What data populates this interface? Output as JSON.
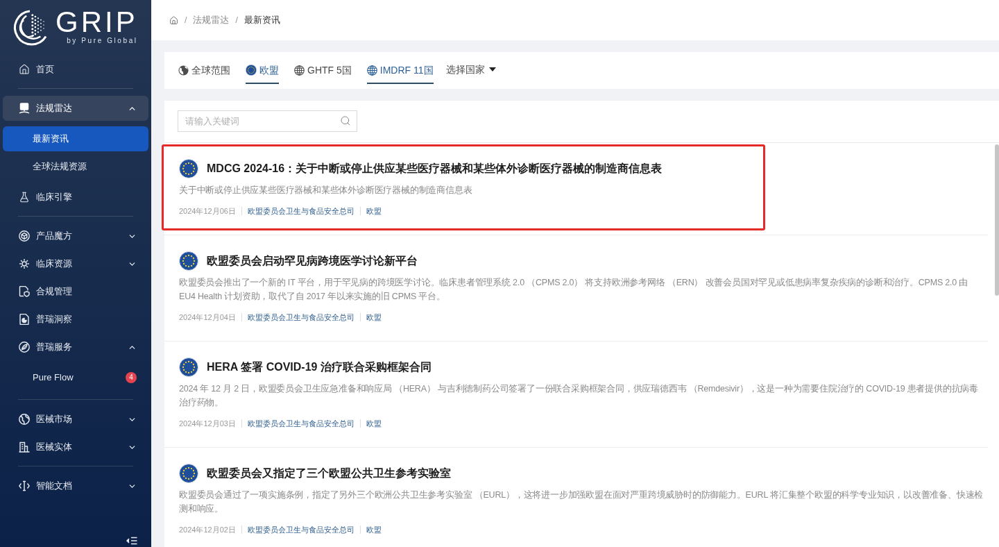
{
  "sidebar": {
    "logo": {
      "wordmark": "GRIP",
      "tagline": "by Pure Global"
    },
    "groups": [
      {
        "items": [
          {
            "label": "首页",
            "selected": false
          }
        ]
      },
      {
        "items": [
          {
            "label": "法规雷达",
            "selected": true,
            "expanded": true,
            "children": [
              {
                "label": "最新资讯",
                "selected": true
              },
              {
                "label": "全球法规资源",
                "selected": false
              }
            ]
          },
          {
            "label": "临床引擎",
            "selected": false
          }
        ]
      },
      {
        "items": [
          {
            "label": "产品魔方",
            "selected": false,
            "expanded": false
          },
          {
            "label": "临床资源",
            "selected": false,
            "expanded": false
          },
          {
            "label": "合规管理",
            "selected": false
          },
          {
            "label": "普瑞洞察",
            "selected": false
          },
          {
            "label": "普瑞服务",
            "selected": false,
            "expanded": true,
            "children": [
              {
                "label": "Pure Flow",
                "selected": false,
                "badge": "4"
              }
            ]
          }
        ]
      },
      {
        "items": [
          {
            "label": "医械市场",
            "selected": false,
            "expanded": false
          },
          {
            "label": "医械实体",
            "selected": false,
            "expanded": false
          }
        ]
      },
      {
        "items": [
          {
            "label": "智能文档",
            "selected": false,
            "expanded": false
          }
        ]
      }
    ]
  },
  "breadcrumb": {
    "separator": "/",
    "items": [
      "法规雷达",
      "最新资讯"
    ]
  },
  "tabs": [
    {
      "label": "全球范围",
      "selected": false
    },
    {
      "label": "欧盟",
      "selected": true
    },
    {
      "label": "GHTF 5国",
      "selected": false
    },
    {
      "label": "IMDRF 11国",
      "selected": true
    }
  ],
  "country_select": {
    "label": "选择国家"
  },
  "search": {
    "placeholder": "请输入关键词"
  },
  "articles": [
    {
      "title": "MDCG 2024-16：关于中断或停止供应某些医疗器械和某些体外诊断医疗器械的制造商信息表",
      "summary": "关于中断或停止供应某些医疗器械和某些体外诊断医疗器械的制造商信息表",
      "date": "2024年12月06日",
      "source": "欧盟委员会卫生与食品安全总司",
      "region": "欧盟",
      "highlighted": true
    },
    {
      "title": "欧盟委员会启动罕见病跨境医学讨论新平台",
      "summary": "欧盟委员会推出了一个新的 IT 平台，用于罕见病的跨境医学讨论。临床患者管理系统 2.0 （CPMS 2.0） 将支持欧洲参考网络 （ERN） 改善会员国对罕见或低患病率复杂疾病的诊断和治疗。CPMS 2.0 由 EU4 Health 计划资助，取代了自 2017 年以来实施的旧 CPMS 平台。",
      "date": "2024年12月04日",
      "source": "欧盟委员会卫生与食品安全总司",
      "region": "欧盟",
      "highlighted": false
    },
    {
      "title": "HERA 签署 COVID-19 治疗联合采购框架合同",
      "summary": "2024 年 12 月 2 日，欧盟委员会卫生应急准备和响应局 （HERA） 与吉利德制药公司签署了一份联合采购框架合同，供应瑞德西韦 （Remdesivir），这是一种为需要住院治疗的 COVID-19 患者提供的抗病毒治疗药物。",
      "date": "2024年12月03日",
      "source": "欧盟委员会卫生与食品安全总司",
      "region": "欧盟",
      "highlighted": false
    },
    {
      "title": "欧盟委员会又指定了三个欧盟公共卫生参考实验室",
      "summary": "欧盟委员会通过了一项实施条例，指定了另外三个欧洲公共卫生参考实验室 （EURL），这将进一步加强欧盟在面对严重跨境威胁时的防御能力。EURL 将汇集整个欧盟的科学专业知识，以改善准备、快速检测和响应。",
      "date": "2024年12月02日",
      "source": "欧盟委员会卫生与食品安全总司",
      "region": "欧盟",
      "highlighted": false
    }
  ]
}
